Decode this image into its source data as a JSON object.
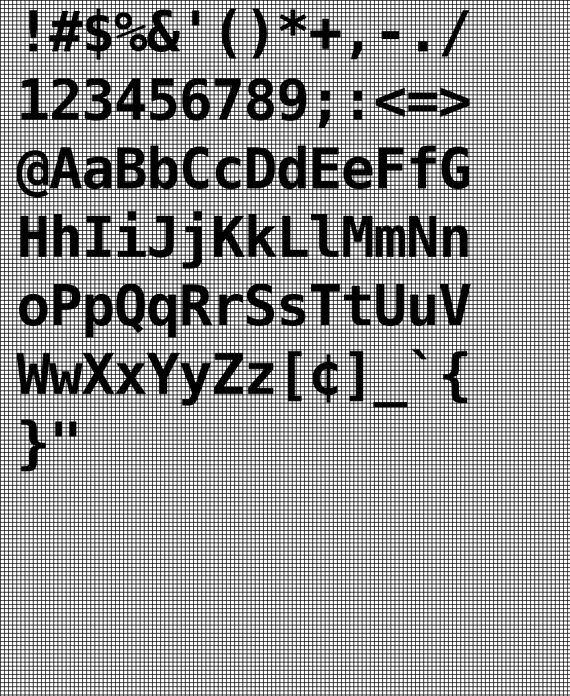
{
  "colors": {
    "grid_line": "#000000",
    "background": "#ffffff",
    "ink": "#000000"
  },
  "glyph_rows": [
    {
      "text": "!#$%&'()*+,-./"
    },
    {
      "text": "123456789;:<=>"
    },
    {
      "text": "@AaBbCcDdEeFfG"
    },
    {
      "text": "HhIiJjKkLlMmNn"
    },
    {
      "text": "oPpQqRrSsTtUuV"
    },
    {
      "text": "WwXxYyZz[¢]_`{"
    },
    {
      "text": "}\""
    }
  ]
}
